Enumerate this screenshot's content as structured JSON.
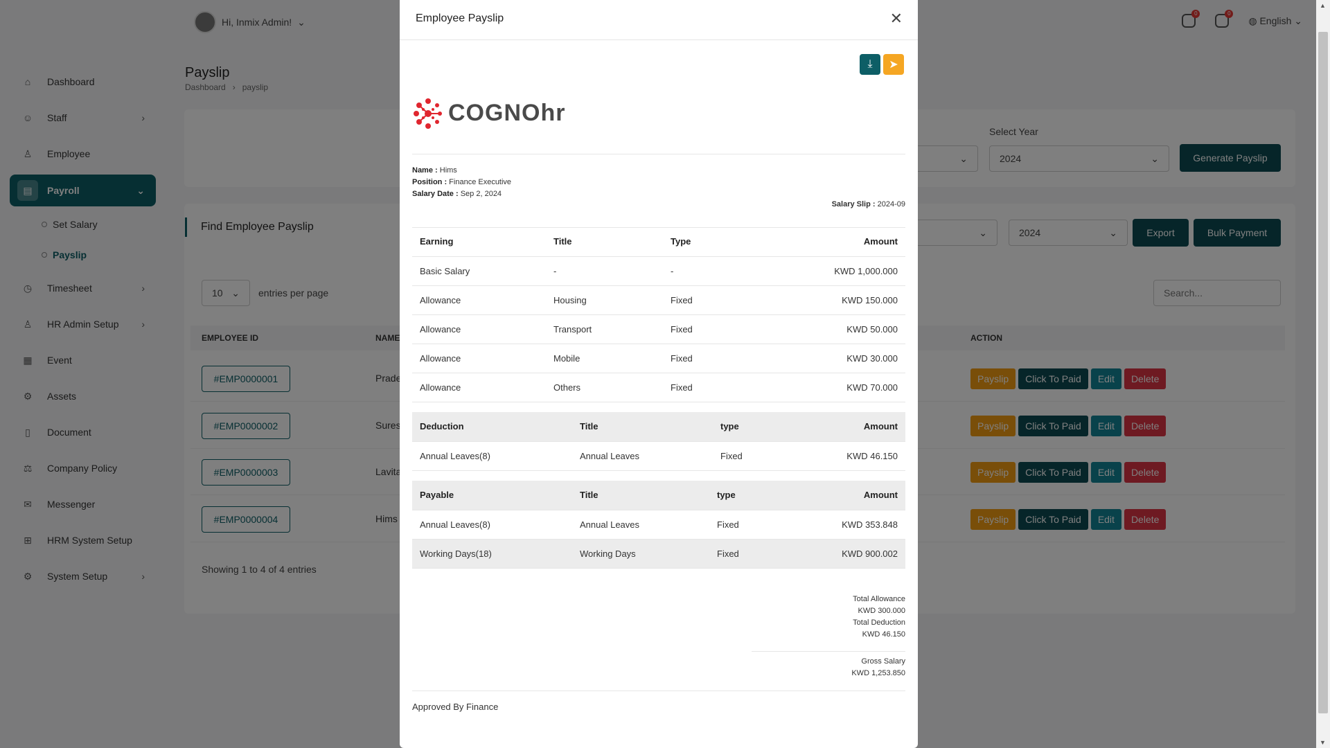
{
  "sidebar": {
    "items": [
      {
        "label": "Dashboard",
        "icon": "home-icon"
      },
      {
        "label": "Staff",
        "icon": "users-icon"
      },
      {
        "label": "Employee",
        "icon": "user-icon"
      },
      {
        "label": "Payroll",
        "icon": "payroll-icon"
      },
      {
        "label": "Timesheet",
        "icon": "clock-icon"
      },
      {
        "label": "HR Admin Setup",
        "icon": "user-plus-icon"
      },
      {
        "label": "Event",
        "icon": "calendar-icon"
      },
      {
        "label": "Assets",
        "icon": "gear-icon"
      },
      {
        "label": "Document",
        "icon": "document-icon"
      },
      {
        "label": "Company Policy",
        "icon": "policy-icon"
      },
      {
        "label": "Messenger",
        "icon": "chat-icon"
      },
      {
        "label": "HRM System Setup",
        "icon": "grid-icon"
      },
      {
        "label": "System Setup",
        "icon": "settings-icon"
      }
    ],
    "payroll_sub": [
      "Set Salary",
      "Payslip"
    ]
  },
  "topbar": {
    "greeting": "Hi, Inmix Admin!",
    "notif1_count": "0",
    "notif2_count": "0",
    "language": "English"
  },
  "page": {
    "title": "Payslip",
    "breadcrumb": [
      "Dashboard",
      "payslip"
    ]
  },
  "filter": {
    "select_year_label": "Select Year",
    "year_value": "2024",
    "generate_label": "Generate Payslip"
  },
  "find": {
    "title": "Find Employee Payslip",
    "year_value": "2024",
    "export_label": "Export",
    "bulk_label": "Bulk Payment",
    "entries_value": "10",
    "entries_text": "entries per page",
    "search_placeholder": "Search...",
    "col_employee_id": "EMPLOYEE ID",
    "col_name": "NAME",
    "col_action": "ACTION",
    "rows": [
      {
        "id": "#EMP0000001",
        "name": "Prade"
      },
      {
        "id": "#EMP0000002",
        "name": "Sures"
      },
      {
        "id": "#EMP0000003",
        "name": "Lavita"
      },
      {
        "id": "#EMP0000004",
        "name": "Hims"
      }
    ],
    "actions": {
      "payslip": "Payslip",
      "paid": "Click To Paid",
      "edit": "Edit",
      "delete": "Delete"
    },
    "showing": "Showing 1 to 4 of 4 entries"
  },
  "modal": {
    "title": "Employee Payslip",
    "logo_text": "COGNOhr",
    "name_label": "Name :",
    "name_value": "Hims",
    "position_label": "Position :",
    "position_value": "Finance Executive",
    "date_label": "Salary Date :",
    "date_value": "Sep 2, 2024",
    "slip_label": "Salary Slip :",
    "slip_value": "2024-09",
    "earning": {
      "headers": [
        "Earning",
        "Title",
        "Type",
        "Amount"
      ],
      "rows": [
        [
          "Basic Salary",
          "-",
          "-",
          "KWD 1,000.000"
        ],
        [
          "Allowance",
          "Housing",
          "Fixed",
          "KWD 150.000"
        ],
        [
          "Allowance",
          "Transport",
          "Fixed",
          "KWD 50.000"
        ],
        [
          "Allowance",
          "Mobile",
          "Fixed",
          "KWD 30.000"
        ],
        [
          "Allowance",
          "Others",
          "Fixed",
          "KWD 70.000"
        ]
      ]
    },
    "deduction": {
      "headers": [
        "Deduction",
        "Title",
        "type",
        "Amount"
      ],
      "rows": [
        [
          "Annual Leaves(8)",
          "Annual Leaves",
          "Fixed",
          "KWD 46.150"
        ]
      ]
    },
    "payable": {
      "headers": [
        "Payable",
        "Title",
        "type",
        "Amount"
      ],
      "rows": [
        [
          "Annual Leaves(8)",
          "Annual Leaves",
          "Fixed",
          "KWD 353.848"
        ],
        [
          "Working Days(18)",
          "Working Days",
          "Fixed",
          "KWD 900.002"
        ]
      ]
    },
    "total_allowance_label": "Total Allowance",
    "total_allowance_value": "KWD 300.000",
    "total_deduction_label": "Total Deduction",
    "total_deduction_value": "KWD 46.150",
    "gross_label": "Gross Salary",
    "gross_value": "KWD 1,253.850",
    "approved": "Approved By Finance"
  },
  "colors": {
    "primary": "#0d5e66",
    "warning": "#f5a623",
    "danger": "#dc3545",
    "info": "#138496"
  }
}
